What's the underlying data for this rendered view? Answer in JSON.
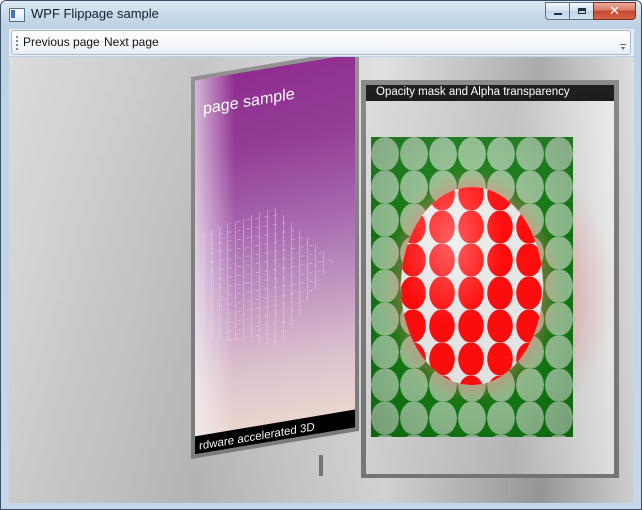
{
  "window": {
    "title": "WPF Flippage sample",
    "minimize_glyph": "minimize-icon",
    "maximize_glyph": "maximize-icon",
    "close_glyph": "✕"
  },
  "toolbar": {
    "previous_label": "Previous page",
    "next_label": "Next page"
  },
  "book": {
    "left_page": {
      "title": "page sample",
      "footer": "rdware accelerated 3D",
      "colors": {
        "top": "#7d0c7d",
        "bottom": "#f7e4d6"
      }
    },
    "right_page": {
      "caption": "Opacity mask and Alpha transparency",
      "colors": {
        "dots_background": "#127a12",
        "red_dots": "#ff0d0d"
      }
    }
  },
  "colors": {
    "titlebar": "#c9dbeb",
    "close_button": "#c4472c",
    "page_frame": "#7a7a7a"
  }
}
